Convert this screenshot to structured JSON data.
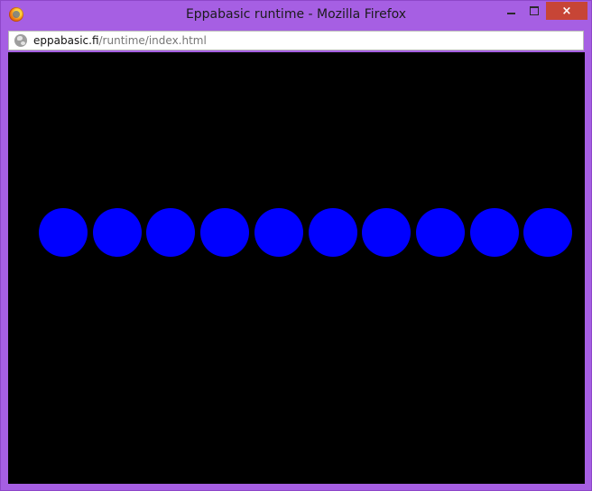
{
  "window": {
    "title": "Eppabasic runtime - Mozilla Firefox",
    "icon": "firefox-icon",
    "controls": {
      "minimize": "minimize-icon",
      "maximize": "maximize-icon",
      "close": "×"
    }
  },
  "address_bar": {
    "icon": "globe-icon",
    "domain": "eppabasic.fi",
    "path": "/runtime/index.html"
  },
  "canvas": {
    "background": "#000000",
    "circle_color": "#0000ff",
    "circle_count": 10
  },
  "colors": {
    "frame": "#a65fe3",
    "close_button": "#c74536"
  }
}
